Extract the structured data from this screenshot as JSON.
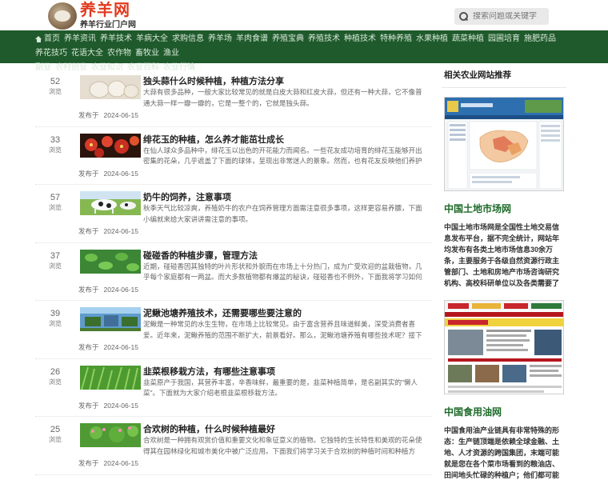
{
  "header": {
    "logo_title": "养羊网",
    "logo_subtitle": "养羊行业门户网",
    "search_placeholder": "搜索问题或关键字"
  },
  "nav": {
    "row1": [
      "首页",
      "养羊资讯",
      "养羊技术",
      "羊病大全",
      "求购信息",
      "养羊场",
      "羊肉食谱",
      "养殖宝典",
      "养殖技术",
      "种植技术",
      "特种养殖",
      "水果种植",
      "蔬菜种植",
      "园圃培育",
      "施肥药品",
      "养花技巧",
      "花语大全",
      "农作物",
      "畜牧业",
      "渔业"
    ],
    "row2": [
      "副业",
      "农村创业",
      "农业知识",
      "农业百科",
      "农业行情"
    ]
  },
  "articles": [
    {
      "count": "52",
      "count_label": "浏览",
      "title": "独头蒜什么时候种植，种植方法分享",
      "desc": "大蒜有很多品种，一般大家比较常见的就是白皮大蒜和红皮大蒜，但还有一种大蒜，它不像普通大蒜一样一瓣一瓣的，它是一整个的，它就是独头蒜。",
      "meta_label": "发布于",
      "date": "2024-06-15",
      "thumb": "garlic"
    },
    {
      "count": "33",
      "count_label": "浏览",
      "title": "绯花玉的种植，怎么养才能茁壮成长",
      "desc": "在仙人球众多品种中，绯花玉以出色的开花能力而闻名。一些花友成功培育的绯花玉能够开出密集的花朵，几乎遮盖了下面的球体，呈现出非常迷人的景象。然而，也有花友反映他们养护的绯花玉只能开一两",
      "meta_label": "发布于",
      "date": "2024-06-15",
      "thumb": "flower"
    },
    {
      "count": "57",
      "count_label": "浏览",
      "title": "奶牛的饲养，注意事项",
      "desc": "秋季天气比较凉爽，养殖奶牛的农户在饲养管理方面需注意很多事项，这样更容易养膘，下面小编就来给大家讲讲需注意的事项。",
      "meta_label": "发布于",
      "date": "2024-06-15",
      "thumb": "cow"
    },
    {
      "count": "37",
      "count_label": "浏览",
      "title": "碰碰香的种植步骤，管理方法",
      "desc": "近期，碰碰香因其独特的叶片形状和外貌而在市场上十分热门，成为广受欢迎的盆栽植物，几乎每个家庭都有一两盆。而大多数植物都有爆盆的秘诀，碰碰香也不例外，下面我将学习如何养护碰碰香使其爆盆？",
      "meta_label": "发布于",
      "date": "2024-06-15",
      "thumb": "pea"
    },
    {
      "count": "39",
      "count_label": "浏览",
      "title": "泥鳅池塘养殖技术，还需要哪些要注意的",
      "desc": "泥鳅是一种常见的水生生物，在市场上比较常见。由于富含营养且味道鲜美，深受消费者喜爱。近年来，泥鳅养殖的范围不断扩大，前景看好。那么，泥鳅池塘养殖有哪些技术呢？接下来了解一下吧！",
      "meta_label": "发布于",
      "date": "2024-06-15",
      "thumb": "pond"
    },
    {
      "count": "26",
      "count_label": "浏览",
      "title": "韭菜根移栽方法，有哪些注意事项",
      "desc": "韭菜原产于我国，其营养丰富，辛香味鲜，最重要的是，韭菜种植简单，是名副其实的\"懒人菜\"。下面就为大家介绍老根韭菜根移栽方法。",
      "meta_label": "发布于",
      "date": "2024-06-15",
      "thumb": "leek"
    },
    {
      "count": "25",
      "count_label": "浏览",
      "title": "合欢树的种植，什么时候种植最好",
      "desc": "合欢树是一种拥有观赏价值和重要文化和象征意义的植物。它独特的生长特性和美观的花朵使得其在园林绿化和城市美化中被广泛应用。下面我们将学习关于合欢树的种植时间和种植方法。",
      "meta_label": "发布于",
      "date": "2024-06-15",
      "thumb": "tree"
    }
  ],
  "sidebar": {
    "heading": "相关农业网站推荐",
    "sites": [
      {
        "title": "中国土地市场网",
        "desc": "中国土地市场网是全国性土地交易信息发布平台，据不完全统计，网站年均发布有各类土地市场信息30余万条，主要服务于各级自然资源行政主管部门、土地和房地产市场咨询研究机构、高校科研单位以及各类需要了解土地交易信息的企"
      },
      {
        "title": "中国食用油网",
        "desc": "中国食用油产业链具有非常特殊的形态：生产链顶端是依赖全球金融、土地、人才资源的跨国集团，末端可能就是您在各个菜市场看到的粮油店、田间地头忙碌的种植户；他们都可能是oilcn的会员，身份虽有不同，但都需要及时、准确、有效的资讯的阅读权和发布"
      }
    ]
  },
  "colors": {
    "nav_bg": "#1f5a2c",
    "logo_red": "#e03a1e",
    "site_title_green": "#1e6a2a"
  }
}
